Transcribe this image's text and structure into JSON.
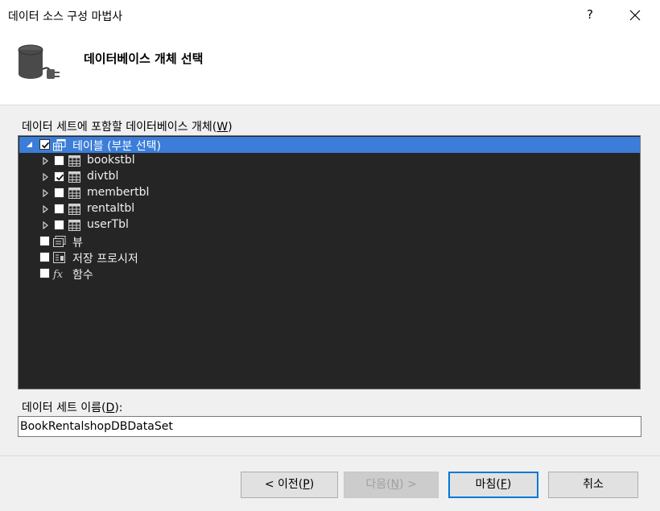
{
  "window": {
    "title": "데이터 소스 구성 마법사",
    "help_label": "?"
  },
  "header": {
    "heading": "데이터베이스 개체 선택"
  },
  "objects": {
    "label": "데이터 세트에 포함할 데이터베이스 개체(W)",
    "label_prefix": "데이터 세트에 포함할 데이터베이스 개체(",
    "label_mnemonic": "W",
    "label_suffix": ")",
    "tree": [
      {
        "label": "테이블 (부분 선택)",
        "checked": true,
        "expanded": true,
        "selected": true,
        "icon": "tables-icon"
      },
      {
        "label": "bookstbl",
        "checked": false,
        "icon": "table-icon"
      },
      {
        "label": "divtbl",
        "checked": true,
        "icon": "table-icon"
      },
      {
        "label": "membertbl",
        "checked": false,
        "icon": "table-icon"
      },
      {
        "label": "rentaltbl",
        "checked": false,
        "icon": "table-icon"
      },
      {
        "label": "userTbl",
        "checked": false,
        "icon": "table-icon"
      },
      {
        "label": "뷰",
        "checked": false,
        "icon": "view-icon"
      },
      {
        "label": "저장 프로시저",
        "checked": false,
        "icon": "stored-procedure-icon"
      },
      {
        "label": "함수",
        "checked": false,
        "icon": "function-icon"
      }
    ]
  },
  "dataset": {
    "label_prefix": "데이터 세트 이름(",
    "label_mnemonic": "D",
    "label_suffix": "):",
    "value": "BookRentalshopDBDataSet"
  },
  "buttons": {
    "prev": {
      "prefix": "< 이전(",
      "mnemonic": "P",
      "suffix": ")"
    },
    "next": {
      "prefix": "다음(",
      "mnemonic": "N",
      "suffix": ") >",
      "disabled": true
    },
    "finish": {
      "prefix": "마침(",
      "mnemonic": "F",
      "suffix": ")"
    },
    "cancel": {
      "label": "취소"
    }
  },
  "colors": {
    "tree_background": "#252526",
    "selection": "#3b7dd8",
    "default_button_border": "#0078d7"
  }
}
